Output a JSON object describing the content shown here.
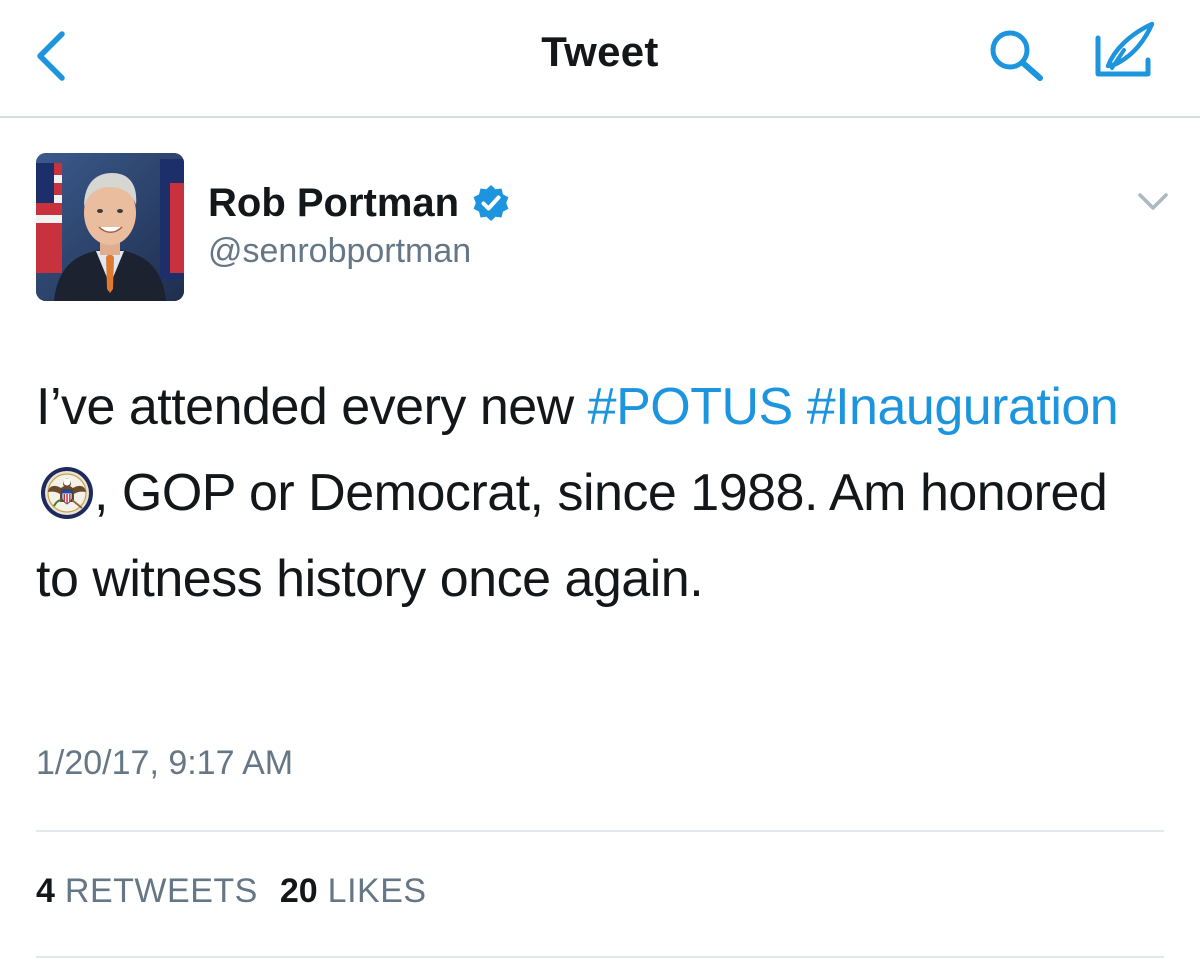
{
  "navbar": {
    "title": "Tweet",
    "back_icon": "chevron-left-icon",
    "search_icon": "search-icon",
    "compose_icon": "compose-icon"
  },
  "tweet": {
    "author": {
      "name": "Rob Portman",
      "handle": "@senrobportman",
      "verified": true,
      "avatar": "avatar-photo"
    },
    "text": {
      "part1": "I’ve attended every new ",
      "hashtag1": "#POTUS",
      "space": " ",
      "hashtag2": "#Inauguration",
      "emoji": "presidential-seal-emoji",
      "part2": ", GOP or Democrat, since 1988. Am honored to witness history once again."
    },
    "timestamp": "1/20/17, 9:17 AM",
    "stats": {
      "retweets_count": "4",
      "retweets_label": "RETWEETS",
      "likes_count": "20",
      "likes_label": "LIKES"
    }
  },
  "colors": {
    "accent": "#1d95de",
    "text": "#14171a",
    "secondary": "#657786",
    "divider": "#e1e8ed"
  }
}
